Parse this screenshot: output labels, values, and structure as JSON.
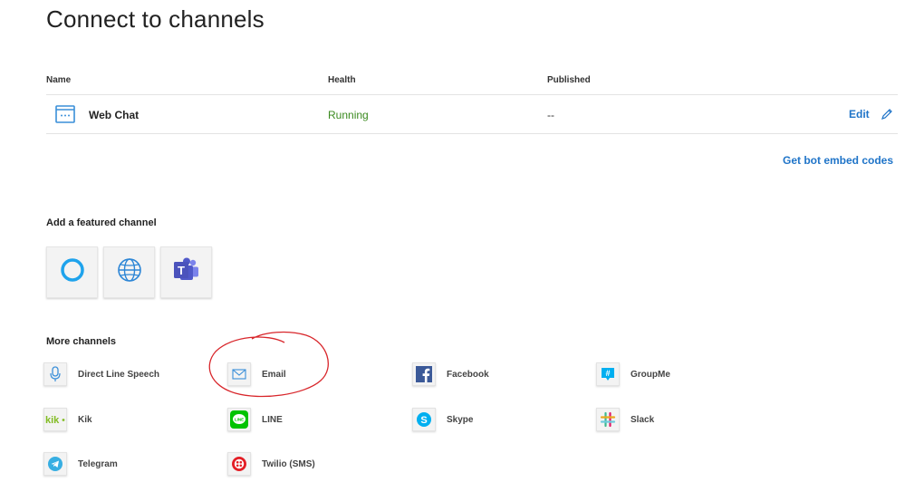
{
  "page": {
    "title": "Connect to channels"
  },
  "table": {
    "headers": {
      "name": "Name",
      "health": "Health",
      "published": "Published"
    },
    "rows": [
      {
        "icon": "web-chat-icon",
        "name": "Web Chat",
        "health": "Running",
        "published": "--",
        "action": "Edit"
      }
    ]
  },
  "embed_link": "Get bot embed codes",
  "featured": {
    "heading": "Add a featured channel",
    "tiles": [
      {
        "icon": "cortana-icon"
      },
      {
        "icon": "globe-icon"
      },
      {
        "icon": "teams-icon"
      }
    ]
  },
  "more": {
    "heading": "More channels",
    "channels": [
      {
        "label": "Direct Line Speech",
        "icon": "microphone-icon"
      },
      {
        "label": "Email",
        "icon": "email-icon"
      },
      {
        "label": "Facebook",
        "icon": "facebook-icon"
      },
      {
        "label": "GroupMe",
        "icon": "groupme-icon"
      },
      {
        "label": "Kik",
        "icon": "kik-icon"
      },
      {
        "label": "LINE",
        "icon": "line-icon"
      },
      {
        "label": "Skype",
        "icon": "skype-icon"
      },
      {
        "label": "Slack",
        "icon": "slack-icon"
      },
      {
        "label": "Telegram",
        "icon": "telegram-icon"
      },
      {
        "label": "Twilio (SMS)",
        "icon": "twilio-icon"
      }
    ]
  },
  "colors": {
    "link": "#1f74c8",
    "running": "#3a8a1f",
    "annotation": "#d8262b",
    "teams": "#5059c9"
  }
}
